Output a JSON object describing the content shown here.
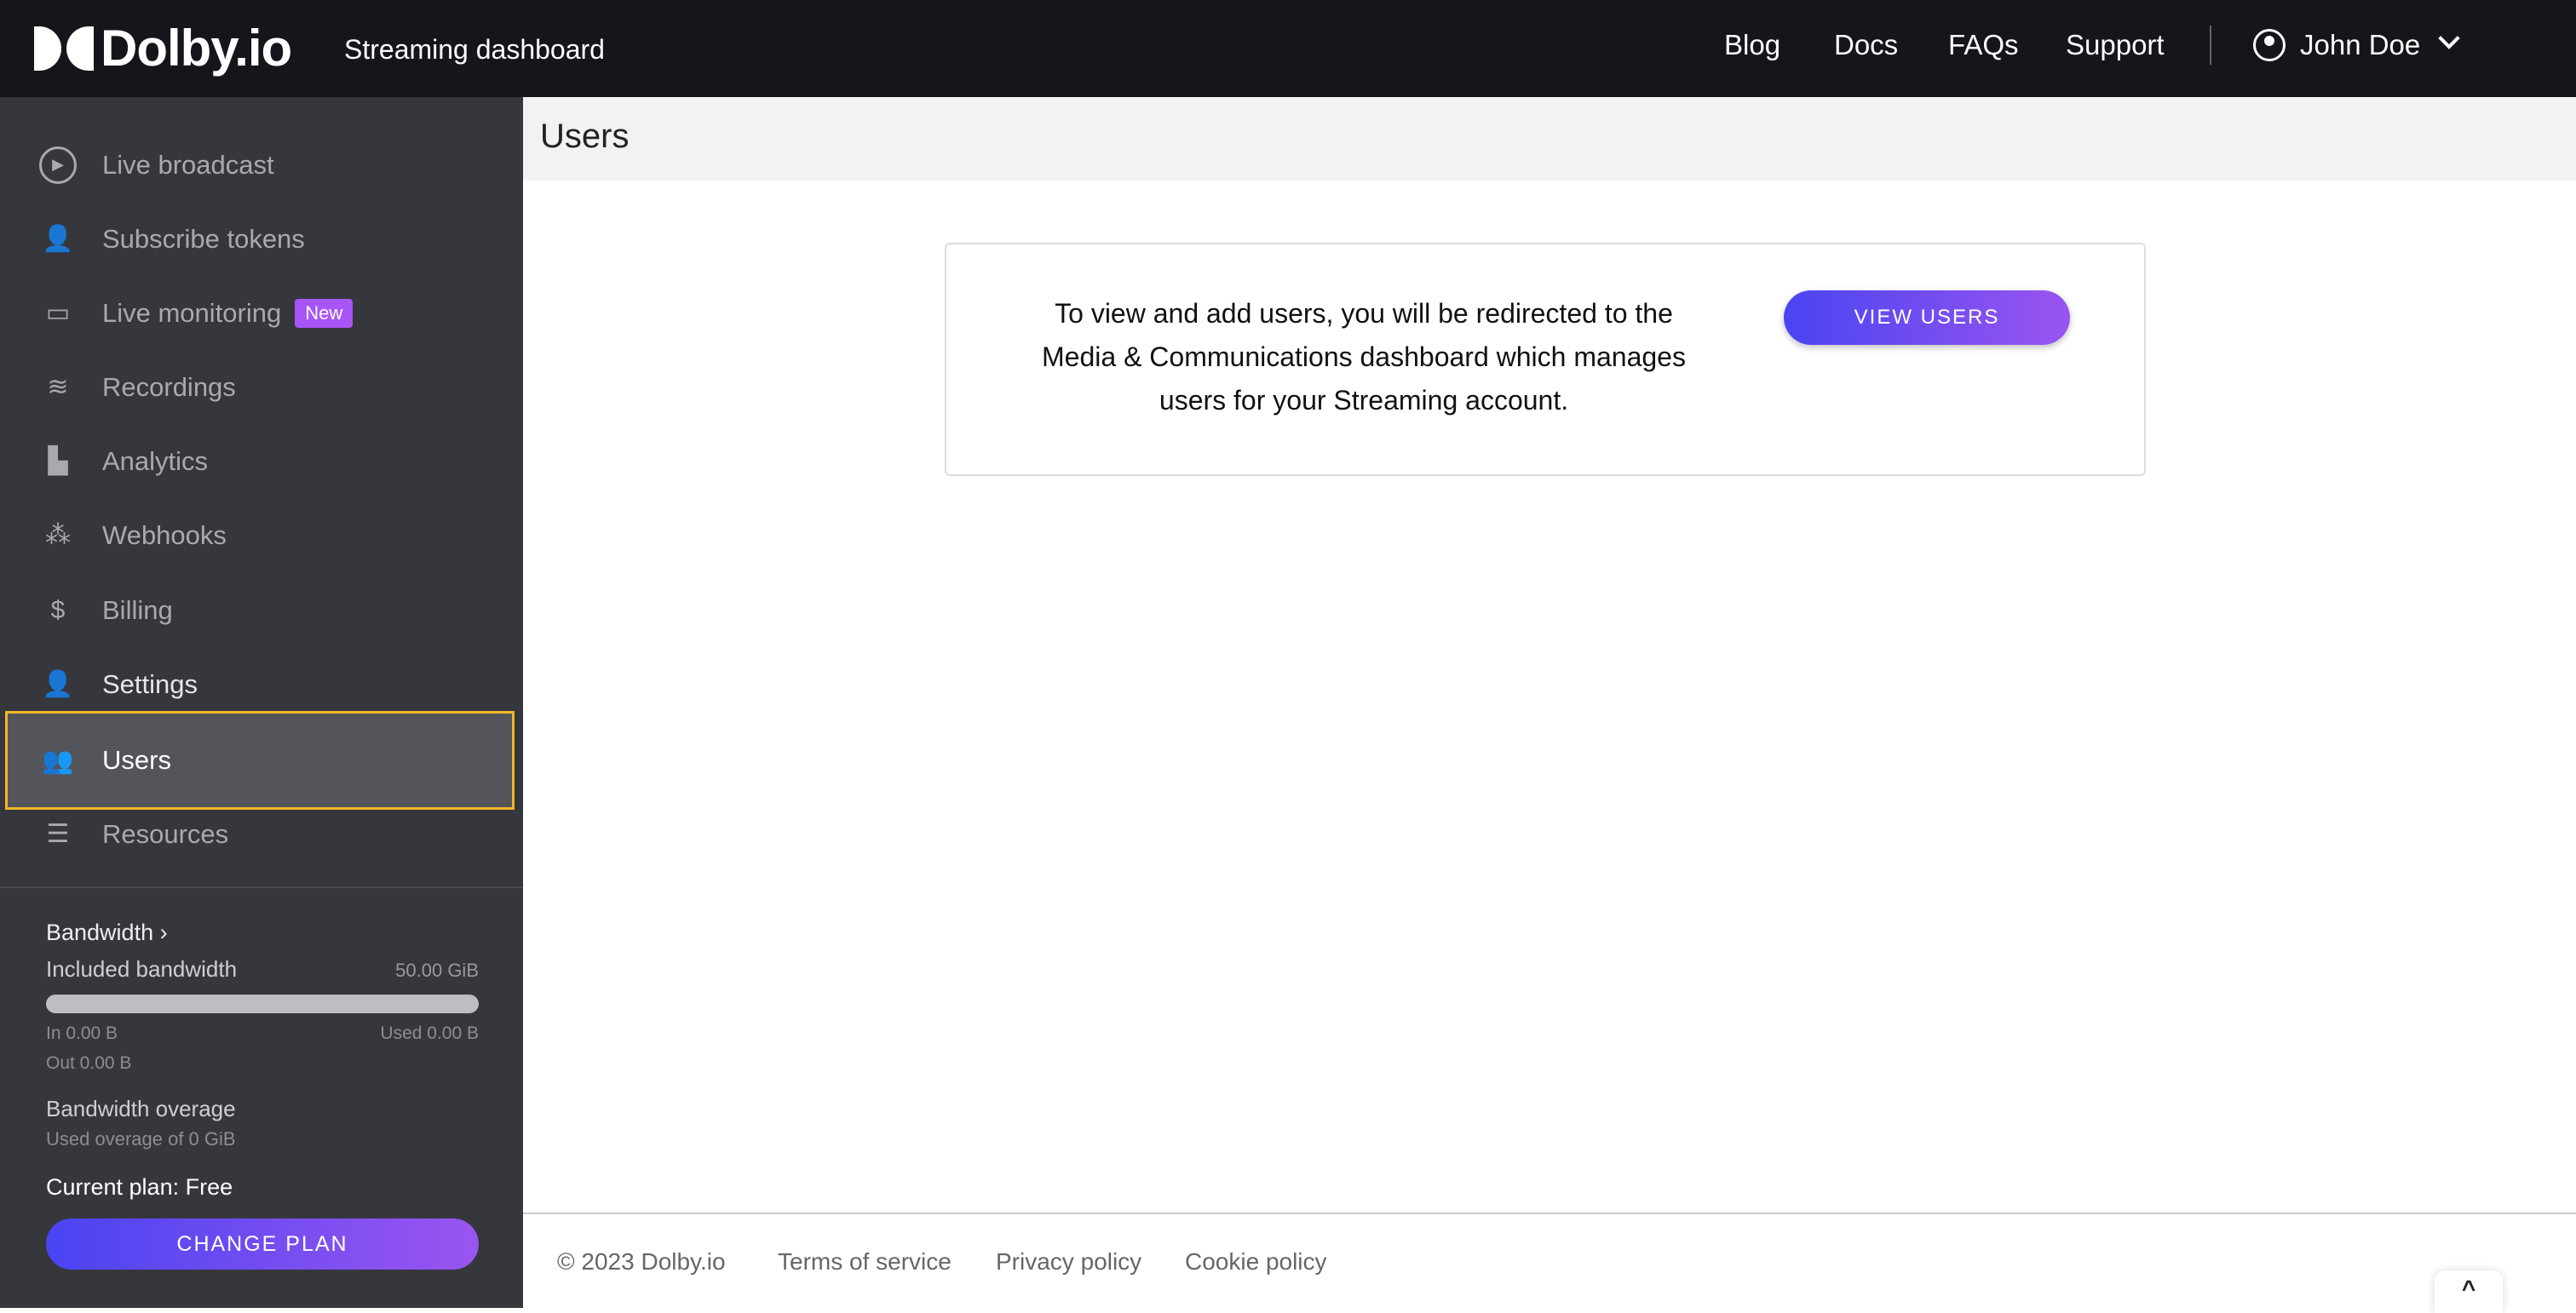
{
  "header": {
    "logo": "Dolby.io",
    "app_title": "Streaming dashboard",
    "nav": [
      "Blog",
      "Docs",
      "FAQs",
      "Support"
    ],
    "user": "John Doe"
  },
  "sidebar": {
    "items": [
      {
        "label": "Live broadcast",
        "icon": "broadcast-icon"
      },
      {
        "label": "Subscribe tokens",
        "icon": "user-token-icon"
      },
      {
        "label": "Live monitoring",
        "icon": "monitor-icon",
        "badge": "New"
      },
      {
        "label": "Recordings",
        "icon": "layers-icon"
      },
      {
        "label": "Analytics",
        "icon": "bar-chart-icon"
      },
      {
        "label": "Webhooks",
        "icon": "webhook-icon"
      },
      {
        "label": "Billing",
        "icon": "dollar-icon"
      },
      {
        "label": "Settings",
        "icon": "user-gear-icon"
      },
      {
        "label": "Users",
        "icon": "users-icon",
        "active": true
      },
      {
        "label": "Resources",
        "icon": "list-icon"
      }
    ]
  },
  "bandwidth": {
    "title": "Bandwidth",
    "included_label": "Included bandwidth",
    "included_value": "50.00 GiB",
    "usage_percent": 0,
    "in": "In 0.00 B",
    "used": "Used 0.00 B",
    "out": "Out 0.00 B",
    "overage_title": "Bandwidth overage",
    "overage_text": "Used overage of 0 GiB",
    "plan": "Current plan: Free",
    "change_plan": "CHANGE PLAN"
  },
  "main": {
    "title": "Users",
    "message": "To view and add users, you will be redirected to the Media & Communications dashboard which manages users for your Streaming account.",
    "view_users": "VIEW USERS"
  },
  "footer": {
    "copyright": "© 2023 Dolby.io",
    "links": [
      "Terms of service",
      "Privacy policy",
      "Cookie policy"
    ]
  },
  "colors": {
    "accent_start": "#4a44f2",
    "accent_end": "#9a55ef",
    "highlight": "#f3b52a",
    "badge": "#a855f7"
  }
}
